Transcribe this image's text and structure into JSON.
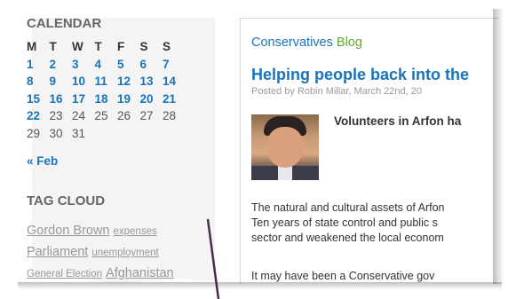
{
  "calendar": {
    "heading": "CALENDAR",
    "days_of_week": [
      "M",
      "T",
      "W",
      "T",
      "F",
      "S",
      "S"
    ],
    "weeks": [
      [
        {
          "d": "1",
          "link": true
        },
        {
          "d": "2",
          "link": true
        },
        {
          "d": "3",
          "link": true
        },
        {
          "d": "4",
          "link": true
        },
        {
          "d": "5",
          "link": true
        },
        {
          "d": "6",
          "link": true
        },
        {
          "d": "7",
          "link": true
        }
      ],
      [
        {
          "d": "8",
          "link": true
        },
        {
          "d": "9",
          "link": true
        },
        {
          "d": "10",
          "link": true
        },
        {
          "d": "11",
          "link": true
        },
        {
          "d": "12",
          "link": true
        },
        {
          "d": "13",
          "link": true
        },
        {
          "d": "14",
          "link": true
        }
      ],
      [
        {
          "d": "15",
          "link": true
        },
        {
          "d": "16",
          "link": true
        },
        {
          "d": "17",
          "link": true
        },
        {
          "d": "18",
          "link": true
        },
        {
          "d": "19",
          "link": true
        },
        {
          "d": "20",
          "link": true
        },
        {
          "d": "21",
          "link": true
        }
      ],
      [
        {
          "d": "22",
          "link": true
        },
        {
          "d": "23",
          "link": false
        },
        {
          "d": "24",
          "link": false
        },
        {
          "d": "25",
          "link": false
        },
        {
          "d": "26",
          "link": false
        },
        {
          "d": "27",
          "link": false
        },
        {
          "d": "28",
          "link": false
        }
      ],
      [
        {
          "d": "29",
          "link": false
        },
        {
          "d": "30",
          "link": false
        },
        {
          "d": "31",
          "link": false
        }
      ]
    ],
    "prev_month": "« Feb"
  },
  "tag_cloud": {
    "heading": "TAG CLOUD",
    "lines": [
      [
        {
          "label": "Gordon Brown",
          "size": "lg"
        },
        {
          "label": "expenses",
          "size": "sm"
        }
      ],
      [
        {
          "label": "Parliament",
          "size": "lg"
        },
        {
          "label": "unemployment",
          "size": "sm"
        }
      ],
      [
        {
          "label": "General Election",
          "size": "sm"
        },
        {
          "label": "Afghanistan",
          "size": "lg"
        }
      ]
    ]
  },
  "article": {
    "blog_name_part1": "Conservatives",
    "blog_name_part2": " Blog",
    "post_title": "Helping people back into the",
    "meta": "Posted by Robin Millar, March 22nd, 20",
    "lead": "Volunteers in Arfon ha",
    "body_lines": [
      "The natural and cultural assets of Arfon",
      "Ten years of state control and public s",
      "sector and weakened the local econom"
    ],
    "para2": "It may have been a Conservative gov"
  },
  "colors": {
    "link_blue": "#1a74b8",
    "blog_green": "#63a832",
    "tag_grey": "#999999",
    "heading_grey": "#666666"
  }
}
